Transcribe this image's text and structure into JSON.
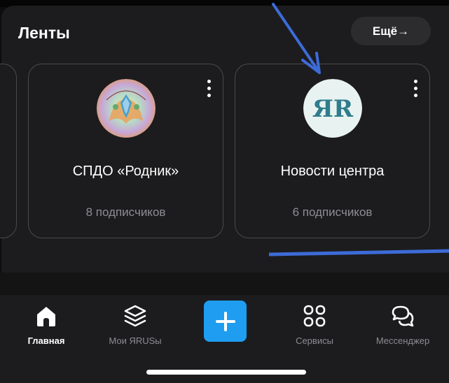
{
  "feeds": {
    "title": "Ленты",
    "more_label": "Ещё→",
    "cards": [
      {
        "name": "СПДО «Родник»",
        "subscribers": "8 подписчиков",
        "avatar_icon": "rodnik-logo-icon"
      },
      {
        "name": "Новости центра",
        "subscribers": "6 подписчиков",
        "avatar_icon": "yar-logo-icon",
        "avatar_text": "ЯR"
      }
    ]
  },
  "tabbar": {
    "tabs": [
      {
        "label": "Главная",
        "icon": "home-icon",
        "active": true
      },
      {
        "label": "Мои ЯRUSы",
        "icon": "layers-icon",
        "active": false
      },
      {
        "label": "",
        "icon": "plus-icon",
        "active": false
      },
      {
        "label": "Сервисы",
        "icon": "grid-icon",
        "active": false
      },
      {
        "label": "Мессенджер",
        "icon": "chat-bubbles-icon",
        "active": false
      }
    ]
  },
  "colors": {
    "background": "#1c1c1e",
    "accent": "#1e9df1",
    "annotation": "#3d6bd8",
    "muted_text": "#8e8e93"
  }
}
